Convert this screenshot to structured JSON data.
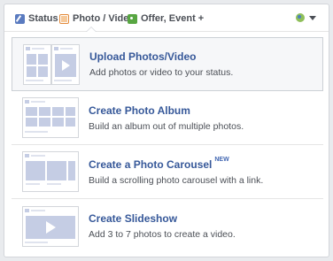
{
  "tabs": [
    {
      "label": "Status",
      "icon": "pencil-icon"
    },
    {
      "label": "Photo / Video",
      "icon": "photo-icon"
    },
    {
      "label": "Offer, Event +",
      "icon": "offer-icon"
    }
  ],
  "audience": {
    "icon": "globe-icon"
  },
  "options": [
    {
      "title": "Upload Photos/Video",
      "description": "Add photos or video to your status.",
      "badge": ""
    },
    {
      "title": "Create Photo Album",
      "description": "Build an album out of multiple photos.",
      "badge": ""
    },
    {
      "title": "Create a Photo Carousel",
      "description": "Build a scrolling photo carousel with a link.",
      "badge": "NEW"
    },
    {
      "title": "Create Slideshow",
      "description": "Add 3 to 7 photos to create a video.",
      "badge": ""
    }
  ],
  "colors": {
    "link": "#365899",
    "thumb": "#c5cde4",
    "border": "#d3d6db"
  }
}
